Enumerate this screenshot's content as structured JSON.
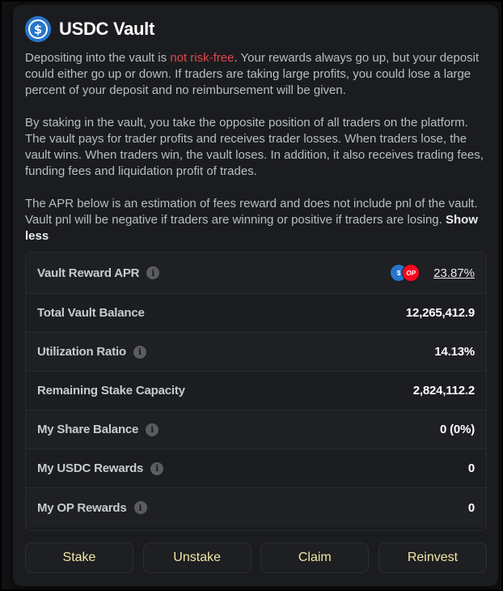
{
  "header": {
    "title": "USDC Vault",
    "logo_icon": "usdc-icon",
    "logo_text": "$"
  },
  "description": {
    "p1_prefix": "Depositing into the vault is ",
    "p1_risk": "not risk-free",
    "p1_suffix": ". Your rewards always go up, but your deposit could either go up or down. If traders are taking large profits, you could lose a large percent of your deposit and no reimbursement will be given.",
    "p2": "By staking in the vault, you take the opposite position of all traders on the platform. The vault pays for trader profits and receives trader losses. When traders lose, the vault wins. When traders win, the vault loses. In addition, it also receives trading fees, funding fees and liquidation profit of trades.",
    "p3": "The APR below is an estimation of fees reward and does not include pnl of the vault. Vault pnl will be negative if traders are winning or positive if traders are losing.",
    "show_less": "Show less"
  },
  "stats": {
    "apr": {
      "label": "Vault Reward APR",
      "value": "23.87%",
      "token1": "$",
      "token2": "OP"
    },
    "total_balance": {
      "label": "Total Vault Balance",
      "value": "12,265,412.9"
    },
    "utilization": {
      "label": "Utilization Ratio",
      "value": "14.13%"
    },
    "remaining_capacity": {
      "label": "Remaining Stake Capacity",
      "value": "2,824,112.2"
    },
    "share_balance": {
      "label": "My Share Balance",
      "value": "0 (0%)"
    },
    "usdc_rewards": {
      "label": "My USDC Rewards",
      "value": "0"
    },
    "op_rewards": {
      "label": "My OP Rewards",
      "value": "0"
    }
  },
  "info_glyph": "i",
  "actions": {
    "stake": "Stake",
    "unstake": "Unstake",
    "claim": "Claim",
    "reinvest": "Reinvest"
  },
  "colors": {
    "accent_button_text": "#f2e6a6",
    "risk_text": "#e0474c",
    "usdc_blue": "#2775ca",
    "op_red": "#ff0420"
  }
}
